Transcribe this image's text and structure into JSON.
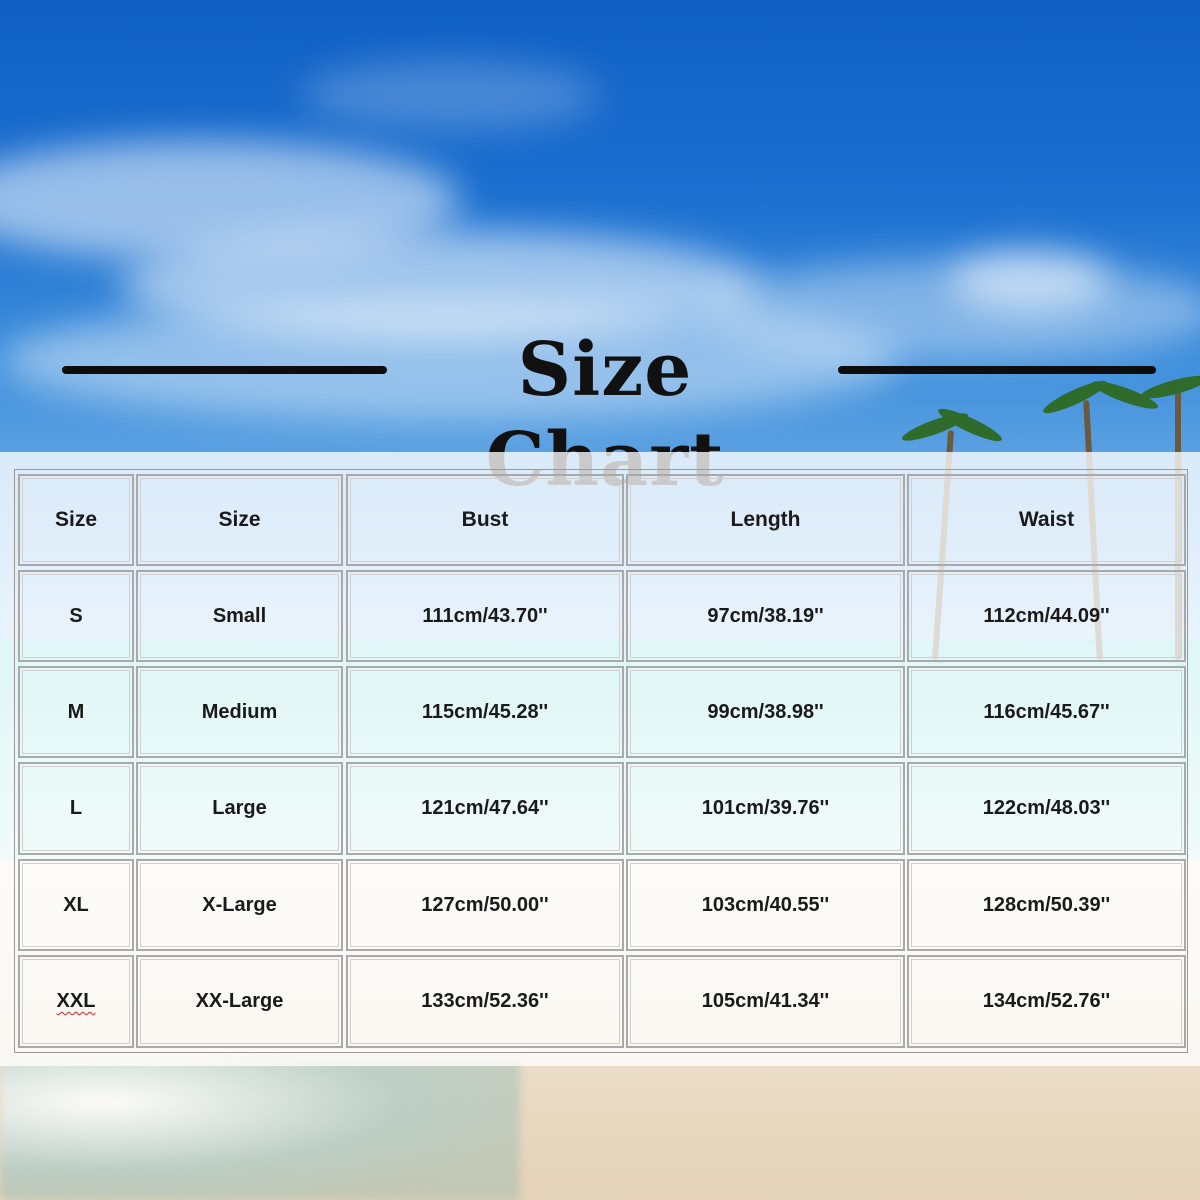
{
  "title": "Size Chart",
  "table": {
    "headers": [
      "Size",
      "Size",
      "Bust",
      "Length",
      "Waist"
    ],
    "rows": [
      [
        "S",
        "Small",
        "111cm/43.70''",
        "97cm/38.19''",
        "112cm/44.09''"
      ],
      [
        "M",
        "Medium",
        "115cm/45.28''",
        "99cm/38.98''",
        "116cm/45.67''"
      ],
      [
        "L",
        "Large",
        "121cm/47.64''",
        "101cm/39.76''",
        "122cm/48.03''"
      ],
      [
        "XL",
        "X-Large",
        "127cm/50.00''",
        "103cm/40.55''",
        "128cm/50.39''"
      ],
      [
        "XXL",
        "XX-Large",
        "133cm/52.36''",
        "105cm/41.34''",
        "134cm/52.76''"
      ]
    ]
  }
}
